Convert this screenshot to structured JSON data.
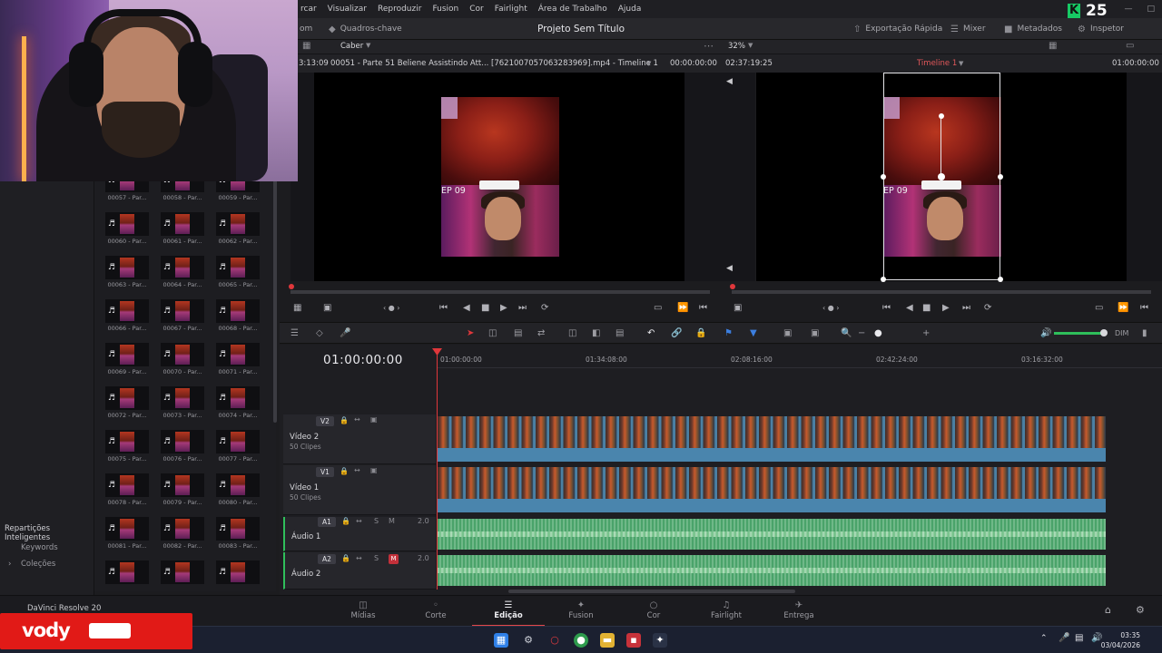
{
  "menubar": {
    "items": [
      "rcar",
      "Visualizar",
      "Reproduzir",
      "Fusion",
      "Cor",
      "Fairlight",
      "Área de Trabalho",
      "Ajuda"
    ],
    "score": "25",
    "score_badge": "K"
  },
  "toolbar": {
    "media_label": "om",
    "keyframes_label": "Quadros-chave",
    "project_title": "Projeto Sem Título",
    "quick_export": "Exportação Rápida",
    "mixer": "Mixer",
    "metadata": "Metadados",
    "inspector": "Inspetor"
  },
  "viewer": {
    "fit_label": "Caber",
    "zoom": "32%",
    "clip_time_left": "3:13:09",
    "clip_name": "00051 - Parte 51 Beliene Assistindo Att... [7621007057063283969].mp4 - Timeline 1",
    "source_timecode": "00:00:00:00",
    "timeline_duration": "02:37:19:25",
    "timeline_name": "Timeline 1",
    "timeline_timecode": "01:00:00:00",
    "ep_text": "EP 09"
  },
  "timeline": {
    "timecode": "01:00:00:00",
    "ruler": [
      "01:00:00:00",
      "01:34:08:00",
      "02:08:16:00",
      "02:42:24:00",
      "03:16:32:00"
    ],
    "tracks": [
      {
        "id": "V2",
        "name": "Vídeo 2",
        "sub": "50 Clipes"
      },
      {
        "id": "V1",
        "name": "Vídeo 1",
        "sub": "50 Clipes"
      },
      {
        "id": "A1",
        "name": "Áudio 1",
        "channels": "2.0",
        "solo": "S",
        "mute": "M"
      },
      {
        "id": "A2",
        "name": "Áudio 2",
        "channels": "2.0",
        "solo": "S",
        "mute": "M"
      }
    ],
    "dim_label": "DIM"
  },
  "mediapool": {
    "rows": [
      [
        "00057 - Par...",
        "00058 - Par...",
        "00059 - Par..."
      ],
      [
        "00060 - Par...",
        "00061 - Par...",
        "00062 - Par..."
      ],
      [
        "00063 - Par...",
        "00064 - Par...",
        "00065 - Par..."
      ],
      [
        "00066 - Par...",
        "00067 - Par...",
        "00068 - Par..."
      ],
      [
        "00069 - Par...",
        "00070 - Par...",
        "00071 - Par..."
      ],
      [
        "00072 - Par...",
        "00073 - Par...",
        "00074 - Par..."
      ],
      [
        "00075 - Par...",
        "00076 - Par...",
        "00077 - Par..."
      ],
      [
        "00078 - Par...",
        "00079 - Par...",
        "00080 - Par..."
      ],
      [
        "00081 - Par...",
        "00082 - Par...",
        "00083 - Par..."
      ],
      [
        "",
        "",
        ""
      ]
    ]
  },
  "sidebar": {
    "smart_bins": "Repartições Inteligentes",
    "keywords": "Keywords",
    "collections": "Coleções"
  },
  "pagetabs": {
    "tabs": [
      "Mídias",
      "Corte",
      "Edição",
      "Fusion",
      "Cor",
      "Fairlight",
      "Entrega"
    ],
    "active": "Edição",
    "app_name": "DaVinci Resolve 20"
  },
  "taskbar": {
    "time": "03:35",
    "date": "03/04/2026"
  },
  "overlay": {
    "brand": "vody"
  },
  "colors": {
    "accent_red": "#e0373b",
    "video_clip": "#4a7fa3",
    "audio_clip": "#4aa36a",
    "score_green": "#17c964"
  }
}
